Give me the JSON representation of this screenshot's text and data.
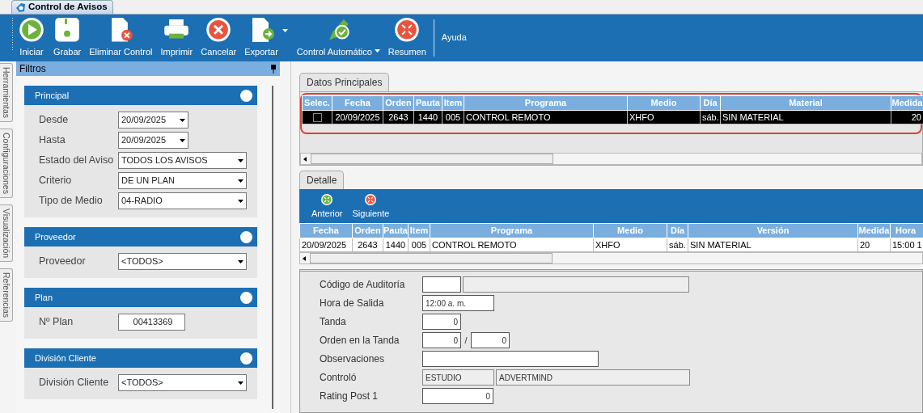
{
  "window": {
    "title": "Control de Avisos"
  },
  "toolbar": [
    {
      "label": "Iniciar",
      "dropdown": false
    },
    {
      "label": "Grabar",
      "dropdown": false
    },
    {
      "label": "Eliminar Control",
      "dropdown": false
    },
    {
      "label": "Imprimir",
      "dropdown": false
    },
    {
      "label": "Cancelar",
      "dropdown": false
    },
    {
      "label": "Exportar",
      "dropdown": true
    },
    {
      "label": "Control Automático",
      "dropdown": true
    },
    {
      "label": "Resumen",
      "dropdown": false
    },
    {
      "label": "Ayuda",
      "dropdown": false
    }
  ],
  "side_tabs": [
    "Herramientas",
    "Configuraciones",
    "Visualización",
    "Referencias"
  ],
  "filters": {
    "title": "Filtros",
    "sections": [
      {
        "title": "Principal",
        "fields": [
          {
            "label": "Desde",
            "kind": "date",
            "value": "20/09/2025"
          },
          {
            "label": "Hasta",
            "kind": "date",
            "value": "20/09/2025"
          },
          {
            "label": "Estado del Aviso",
            "kind": "select",
            "value": "TODOS LOS AVISOS"
          },
          {
            "label": "Criterio",
            "kind": "select",
            "value": "DE UN PLAN"
          },
          {
            "label": "Tipo de Medio",
            "kind": "select",
            "value": "04-RADIO"
          }
        ]
      },
      {
        "title": "Proveedor",
        "fields": [
          {
            "label": "Proveedor",
            "kind": "select",
            "value": "<TODOS>"
          }
        ]
      },
      {
        "title": "Plan",
        "fields": [
          {
            "label": "Nº Plan",
            "kind": "text",
            "value": "00413369"
          }
        ]
      },
      {
        "title": "División Cliente",
        "fields": [
          {
            "label": "División Cliente",
            "kind": "select",
            "value": "<TODOS>"
          }
        ]
      }
    ]
  },
  "main": {
    "tab": "Datos Principales",
    "columns": [
      "Selec.",
      "Fecha",
      "Orden",
      "Pauta",
      "Item",
      "Programa",
      "Medio",
      "Día",
      "Material",
      "Medida"
    ],
    "rows": [
      {
        "selected": true,
        "checked": false,
        "cells": [
          "",
          "20/09/2025",
          "2643",
          "1440",
          "005",
          "CONTROL REMOTO",
          "XHFO",
          "sáb.",
          "SIN MATERIAL",
          "20"
        ]
      }
    ]
  },
  "detail": {
    "tab": "Detalle",
    "nav": [
      {
        "label": "Anterior"
      },
      {
        "label": "Siguiente"
      }
    ],
    "columns": [
      "Fecha",
      "Orden",
      "Pauta",
      "Item",
      "Programa",
      "Medio",
      "Día",
      "Versión",
      "Medida",
      "Hora"
    ],
    "rows": [
      {
        "cells": [
          "20/09/2025",
          "2643",
          "1440",
          "005",
          "CONTROL REMOTO",
          "XHFO",
          "sáb.",
          "SIN MATERIAL",
          "20",
          "15:00 1"
        ]
      }
    ],
    "form": [
      {
        "label": "Código de Auditoría",
        "inputs": [
          {
            "kind": "editable"
          },
          {
            "kind": "readonly"
          }
        ]
      },
      {
        "label": "Hora de Salida",
        "inputs": [
          {
            "kind": "editable",
            "value": "12:00 a. m."
          }
        ]
      },
      {
        "label": "Tanda",
        "inputs": [
          {
            "kind": "number",
            "value": "0"
          }
        ]
      },
      {
        "label": "Orden en la Tanda",
        "separator": "/",
        "inputs": [
          {
            "kind": "number",
            "value": "0"
          },
          {
            "kind": "number",
            "value": "0"
          }
        ]
      },
      {
        "label": "Observaciones",
        "inputs": [
          {
            "kind": "editable"
          }
        ]
      },
      {
        "label": "Controló",
        "inputs": [
          {
            "kind": "readonly",
            "value": "ESTUDIO"
          },
          {
            "kind": "readonly",
            "value": "ADVERTMIND"
          }
        ]
      },
      {
        "label": "Rating Post 1",
        "inputs": [
          {
            "kind": "number",
            "value": "0"
          }
        ]
      }
    ]
  }
}
